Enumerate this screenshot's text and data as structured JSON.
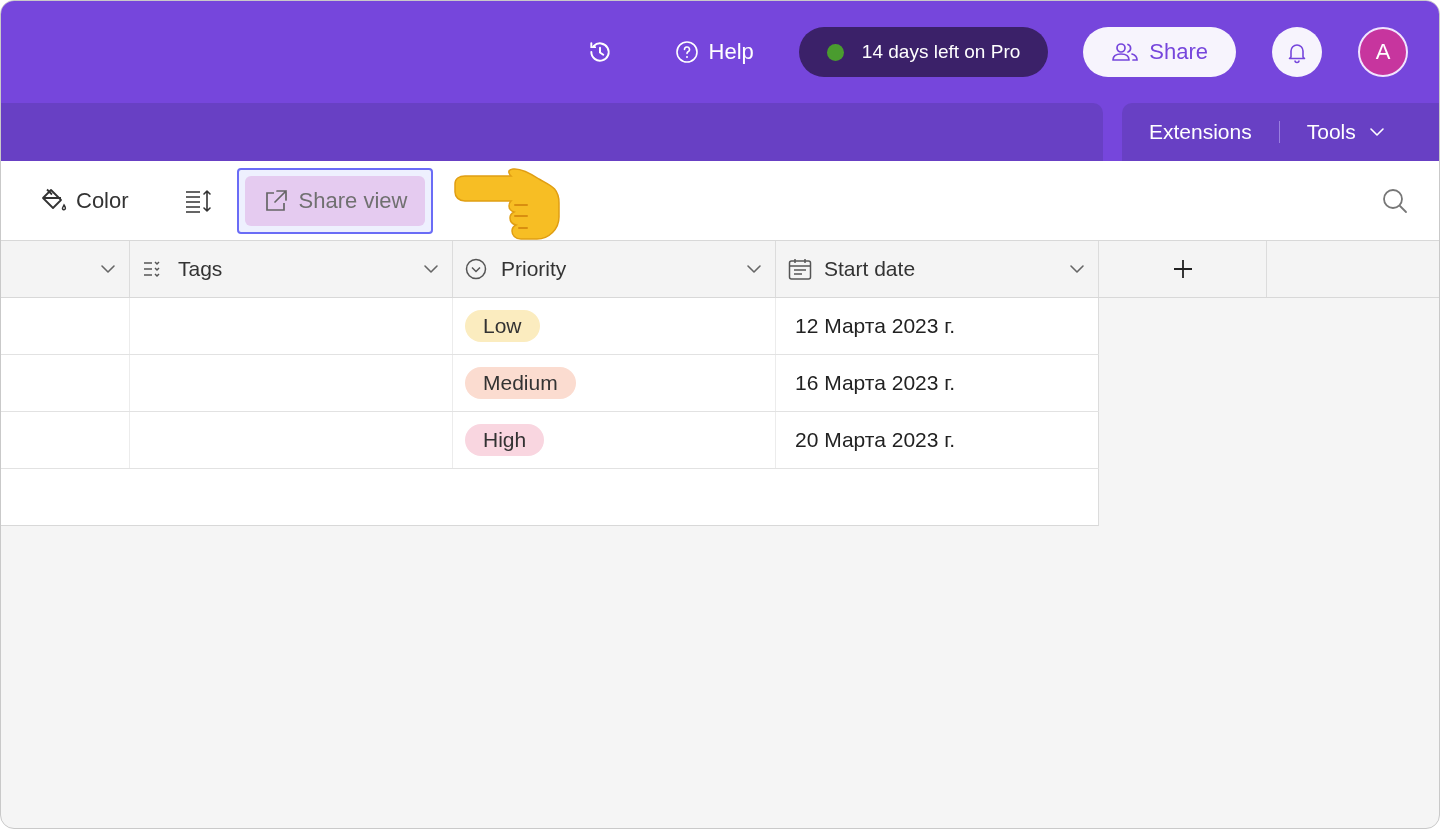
{
  "topbar": {
    "help": "Help",
    "trial": "14 days left on Pro",
    "share": "Share",
    "avatar": "A"
  },
  "subbar": {
    "items": [
      {
        "label": "Extensions",
        "kind": "plain"
      },
      {
        "label": "Tools",
        "kind": "menu"
      }
    ]
  },
  "toolbar": {
    "color_button": "Color",
    "share_view": {
      "label": "Share view",
      "highlighted": true
    }
  },
  "table": {
    "columns": [
      {
        "kind": "blank"
      },
      {
        "label": "Tags",
        "kind": "tags"
      },
      {
        "label": "Priority",
        "kind": "select"
      },
      {
        "label": "Start date",
        "kind": "date"
      }
    ],
    "rows": [
      {
        "priority": {
          "label": "Low",
          "color": "#fbecbf"
        },
        "start_date": "12 Марта 2023 г."
      },
      {
        "priority": {
          "label": "Medium",
          "color": "#fbdcd0"
        },
        "start_date": "16 Марта 2023 г."
      },
      {
        "priority": {
          "label": "High",
          "color": "#f9d6e0"
        },
        "start_date": "20 Марта 2023 г."
      }
    ]
  }
}
